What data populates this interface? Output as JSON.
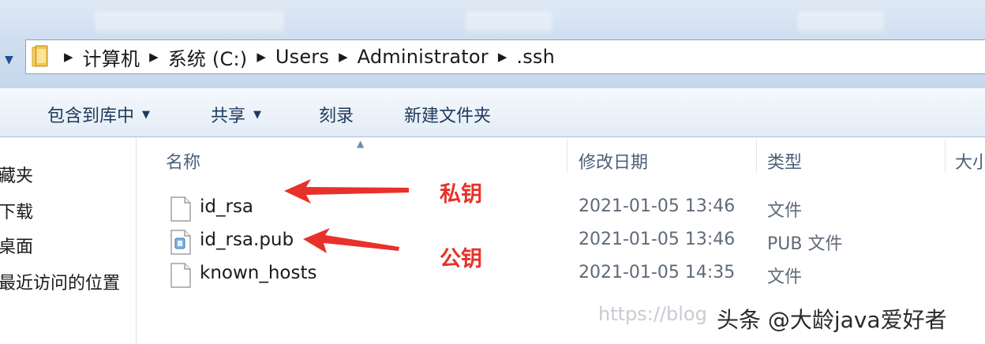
{
  "address_bar": {
    "breadcrumbs": [
      "计算机",
      "系统 (C:)",
      "Users",
      "Administrator",
      ".ssh"
    ]
  },
  "toolbar": {
    "include_in_library": "包含到库中",
    "share": "共享",
    "burn": "刻录",
    "new_folder": "新建文件夹"
  },
  "nav_pane": {
    "items": [
      "藏夹",
      "下载",
      "桌面",
      "最近访问的位置"
    ]
  },
  "columns": {
    "name": "名称",
    "date_modified": "修改日期",
    "type": "类型",
    "size": "大小"
  },
  "files": [
    {
      "name": "id_rsa",
      "date": "2021-01-05 13:46",
      "type": "文件",
      "icon": "blank-file-icon"
    },
    {
      "name": "id_rsa.pub",
      "date": "2021-01-05 13:46",
      "type": "PUB 文件",
      "icon": "pub-file-icon"
    },
    {
      "name": "known_hosts",
      "date": "2021-01-05 14:35",
      "type": "文件",
      "icon": "blank-file-icon"
    }
  ],
  "annotations": {
    "private_key": "私钥",
    "public_key": "公钥",
    "color": "#e8312a"
  },
  "watermark": {
    "url": "https://blog",
    "source": "头条 @大龄java爱好者"
  }
}
